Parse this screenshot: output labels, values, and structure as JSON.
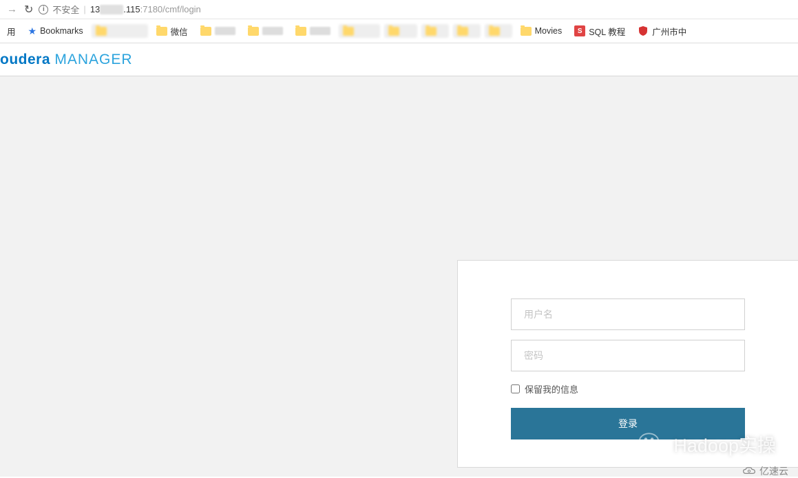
{
  "addressBar": {
    "notSecure": "不安全",
    "urlPrefix": "13",
    "urlSuffix": ".115",
    "urlPort": ":7180/cmf/login"
  },
  "bookmarks": {
    "apps": "用",
    "bookmarksLabel": "Bookmarks",
    "wechat": "微信",
    "movies": "Movies",
    "sqlTutorial": "SQL 教程",
    "guangzhou": "广州市中"
  },
  "brand": {
    "part1": "oudera",
    "part2": "MANAGER"
  },
  "login": {
    "usernamePlaceholder": "用户名",
    "passwordPlaceholder": "密码",
    "rememberLabel": "保留我的信息",
    "loginButton": "登录"
  },
  "watermark": {
    "wechat": "Hadoop实操",
    "yisu": "亿速云"
  }
}
